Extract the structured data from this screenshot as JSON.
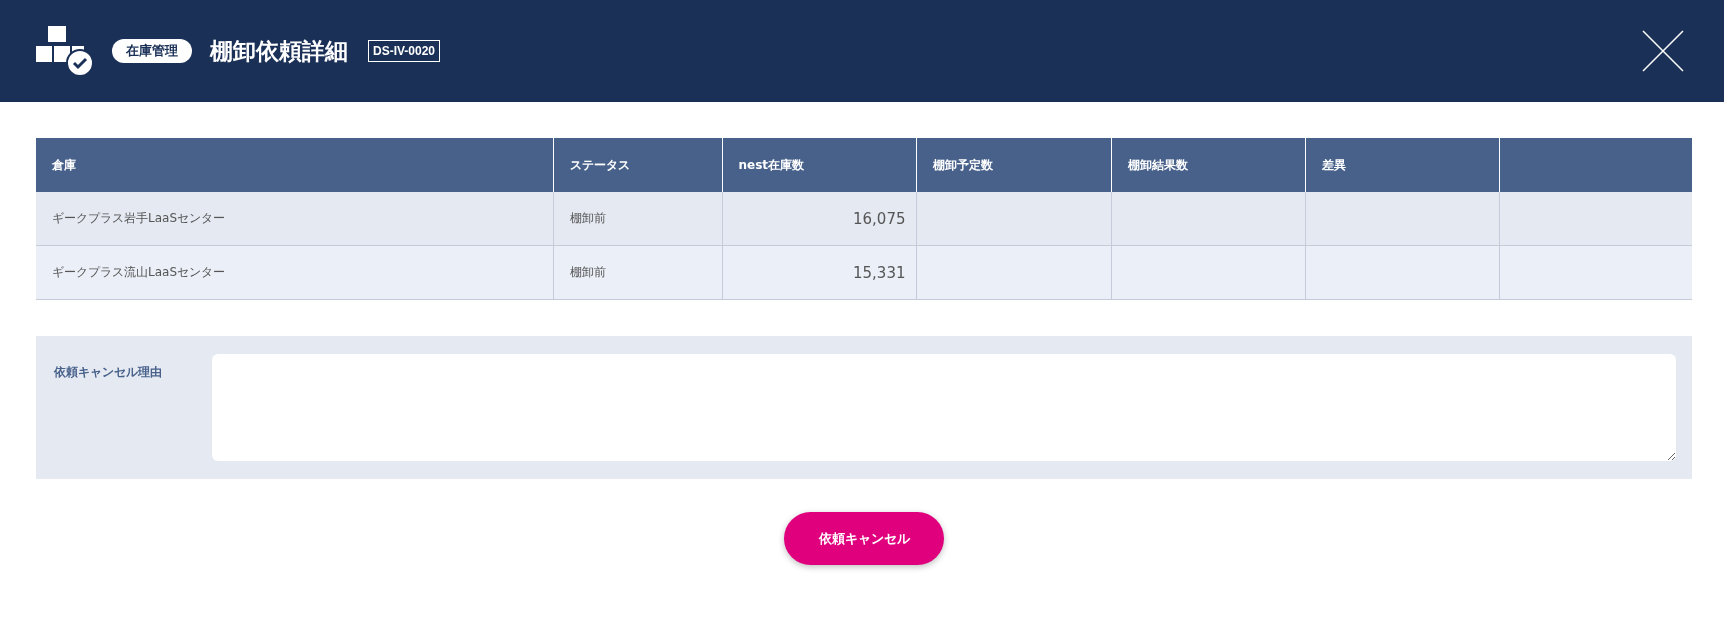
{
  "header": {
    "badge": "在庫管理",
    "title": "棚卸依頼詳細",
    "screen_id": "DS-IV-0020"
  },
  "table": {
    "columns": [
      "倉庫",
      "ステータス",
      "nest在庫数",
      "棚卸予定数",
      "棚卸結果数",
      "差異"
    ],
    "rows": [
      {
        "cells": [
          "ギークプラス岩手LaaSセンター",
          "棚卸前",
          "16,075"
        ]
      },
      {
        "cells": [
          "ギークプラス流山LaaSセンター",
          "棚卸前",
          "15,331"
        ]
      }
    ]
  },
  "form": {
    "label": "依頼キャンセル理由"
  },
  "button": "依頼キャンセル"
}
